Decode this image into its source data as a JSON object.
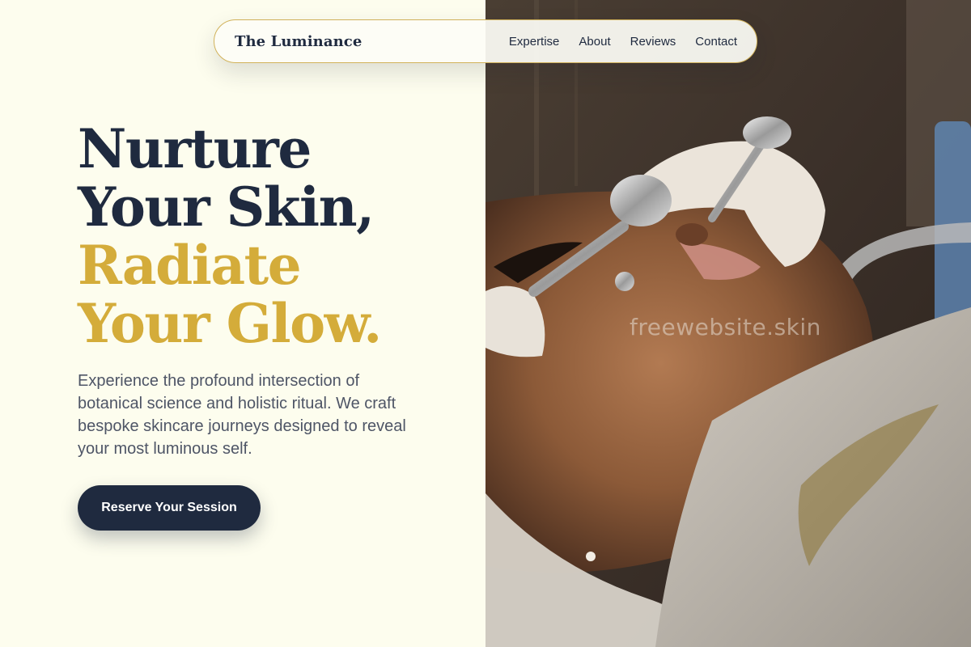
{
  "nav": {
    "brand": "The Luminance",
    "links": [
      "Expertise",
      "About",
      "Reviews",
      "Contact"
    ]
  },
  "hero": {
    "title_lines": [
      "Nurture",
      "Your Skin,",
      "Radiate",
      "Your Glow."
    ],
    "description": "Experience the profound intersection of botanical science and holistic ritual. We craft bespoke skincare journeys designed to reveal your most luminous self.",
    "cta_label": "Reserve Your Session"
  },
  "photo": {
    "watermark": "freewebsite.skin"
  },
  "colors": {
    "background": "#fdfdee",
    "navy": "#1f2a3f",
    "gold": "#d4ac3a",
    "body_text": "#4e5566",
    "nav_border": "#d1b25a"
  }
}
